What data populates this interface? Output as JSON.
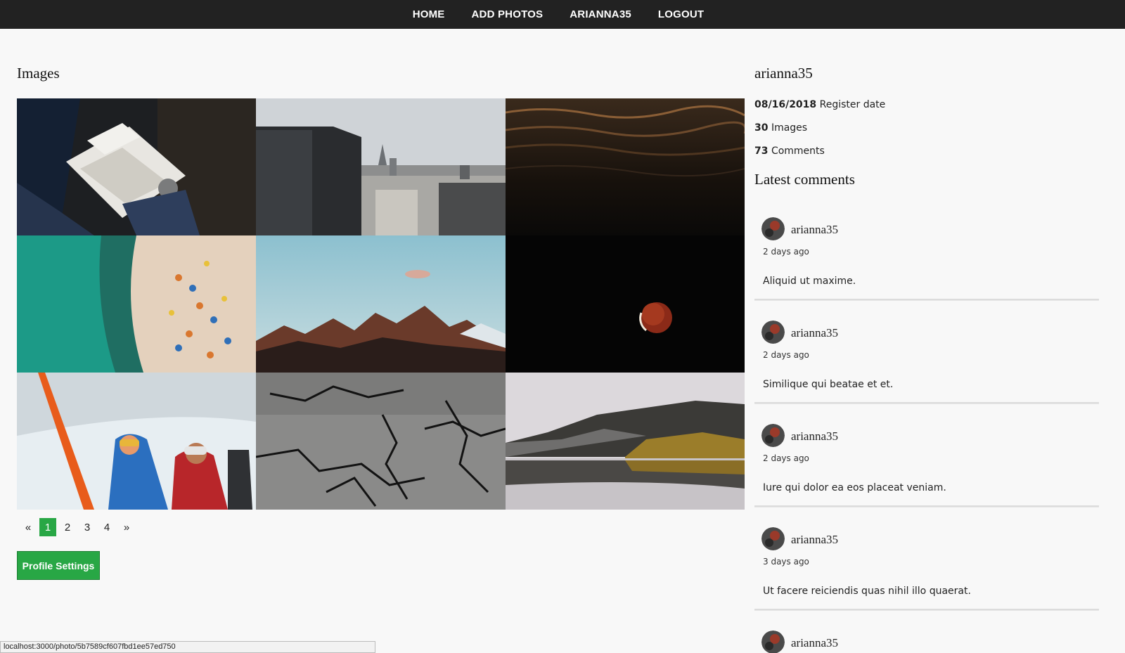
{
  "nav": {
    "items": [
      {
        "label": "HOME"
      },
      {
        "label": "ADD PHOTOS"
      },
      {
        "label": "ARIANNA35"
      },
      {
        "label": "LOGOUT"
      }
    ]
  },
  "images_section": {
    "title": "Images",
    "tiles": [
      {
        "icon": "person-reading-photo"
      },
      {
        "icon": "city-skyline-photo"
      },
      {
        "icon": "water-surface-photo"
      },
      {
        "icon": "beach-aerial-photo"
      },
      {
        "icon": "mountain-sky-photo"
      },
      {
        "icon": "moon-eclipse-photo"
      },
      {
        "icon": "skiers-snow-photo"
      },
      {
        "icon": "cracked-ground-photo"
      },
      {
        "icon": "lake-forest-photo"
      }
    ]
  },
  "pagination": {
    "prev": "«",
    "pages": [
      "1",
      "2",
      "3",
      "4"
    ],
    "active_page": "1",
    "next": "»"
  },
  "profile_settings_label": "Profile Settings",
  "profile": {
    "username": "arianna35",
    "register_date": "08/16/2018",
    "register_label": "Register date",
    "images_count": "30",
    "images_label": "Images",
    "comments_count": "73",
    "comments_label": "Comments"
  },
  "latest_comments": {
    "title": "Latest comments",
    "items": [
      {
        "author": "arianna35",
        "time": "2 days ago",
        "text": "Aliquid ut maxime."
      },
      {
        "author": "arianna35",
        "time": "2 days ago",
        "text": "Similique qui beatae et et."
      },
      {
        "author": "arianna35",
        "time": "2 days ago",
        "text": "Iure qui dolor ea eos placeat veniam."
      },
      {
        "author": "arianna35",
        "time": "3 days ago",
        "text": "Ut facere reiciendis quas nihil illo quaerat."
      },
      {
        "author": "arianna35"
      }
    ]
  },
  "status_bar": {
    "url": "localhost:3000/photo/5b7589cf607fbd1ee57ed750"
  },
  "colors": {
    "navbar": "#222222",
    "accent_green": "#28a745",
    "background": "#f8f8f8"
  }
}
